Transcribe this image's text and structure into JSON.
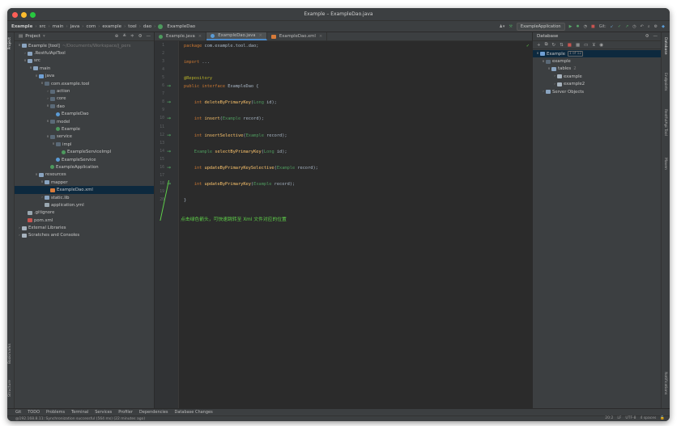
{
  "window": {
    "title": "Example – ExampleDao.java"
  },
  "breadcrumbs": [
    "Example",
    "src",
    "main",
    "java",
    "com",
    "example",
    "tool",
    "dao",
    "ExampleDao"
  ],
  "run_config": "ExampleApplication",
  "project_panel": {
    "title": "Project",
    "tree": [
      {
        "indent": 0,
        "arrow": "∨",
        "icon": "folder",
        "label": "Example [tool]",
        "muted": "~/Documents/Workspace/j_pers"
      },
      {
        "indent": 1,
        "arrow": "›",
        "icon": "folder",
        "label": ".RestfulApiTool"
      },
      {
        "indent": 1,
        "arrow": "∨",
        "icon": "folder",
        "label": "src"
      },
      {
        "indent": 2,
        "arrow": "∨",
        "icon": "folder",
        "label": "main"
      },
      {
        "indent": 3,
        "arrow": "∨",
        "icon": "src",
        "label": "java"
      },
      {
        "indent": 4,
        "arrow": "∨",
        "icon": "pkg",
        "label": "com.example.tool"
      },
      {
        "indent": 5,
        "arrow": "›",
        "icon": "pkg",
        "label": "action"
      },
      {
        "indent": 5,
        "arrow": "›",
        "icon": "pkg",
        "label": "core"
      },
      {
        "indent": 5,
        "arrow": "∨",
        "icon": "pkg",
        "label": "dao"
      },
      {
        "indent": 6,
        "arrow": "",
        "icon": "iface",
        "label": "ExampleDao"
      },
      {
        "indent": 5,
        "arrow": "∨",
        "icon": "pkg",
        "label": "model"
      },
      {
        "indent": 6,
        "arrow": "",
        "icon": "cls",
        "label": "Example"
      },
      {
        "indent": 5,
        "arrow": "∨",
        "icon": "pkg",
        "label": "service"
      },
      {
        "indent": 6,
        "arrow": "∨",
        "icon": "pkg",
        "label": "impl"
      },
      {
        "indent": 7,
        "arrow": "",
        "icon": "cls",
        "label": "ExampleServiceImpl"
      },
      {
        "indent": 6,
        "arrow": "",
        "icon": "iface",
        "label": "ExampleService"
      },
      {
        "indent": 5,
        "arrow": "",
        "icon": "cls",
        "label": "ExampleApplication"
      },
      {
        "indent": 3,
        "arrow": "∨",
        "icon": "folder",
        "label": "resources"
      },
      {
        "indent": 4,
        "arrow": "∨",
        "icon": "folder",
        "label": "mapper"
      },
      {
        "indent": 5,
        "arrow": "",
        "icon": "xml",
        "label": "ExampleDao.xml",
        "selected": true
      },
      {
        "indent": 4,
        "arrow": "›",
        "icon": "folder",
        "label": "static.lib"
      },
      {
        "indent": 4,
        "arrow": "",
        "icon": "file",
        "label": "application.yml"
      },
      {
        "indent": 1,
        "arrow": "",
        "icon": "file",
        "label": ".gitignore"
      },
      {
        "indent": 1,
        "arrow": "",
        "icon": "mvn",
        "label": "pom.xml"
      },
      {
        "indent": 0,
        "arrow": "›",
        "icon": "lib",
        "label": "External Libraries"
      },
      {
        "indent": 0,
        "arrow": "›",
        "icon": "lib",
        "label": "Scratches and Consoles"
      }
    ]
  },
  "editor": {
    "tabs": [
      {
        "label": "Example.java",
        "active": false
      },
      {
        "label": "ExampleDao.java",
        "active": true
      },
      {
        "label": "ExampleDao.xml",
        "active": false
      }
    ],
    "lines": [
      {
        "n": "1",
        "arrow": false,
        "parts": [
          [
            "kw",
            "package "
          ],
          [
            "pkg",
            "com.example.tool.dao"
          ],
          [
            "",
            "; "
          ]
        ]
      },
      {
        "n": "2",
        "arrow": false,
        "parts": []
      },
      {
        "n": "3",
        "arrow": false,
        "parts": [
          [
            "kw",
            "import "
          ],
          [
            "",
            "..."
          ]
        ]
      },
      {
        "n": "4",
        "arrow": false,
        "parts": []
      },
      {
        "n": "5",
        "arrow": false,
        "parts": [
          [
            "ann",
            "@Repository"
          ]
        ]
      },
      {
        "n": "6",
        "arrow": true,
        "parts": [
          [
            "kw",
            "public interface "
          ],
          [
            "",
            "ExampleDao {"
          ]
        ]
      },
      {
        "n": "7",
        "arrow": false,
        "parts": []
      },
      {
        "n": "8",
        "arrow": true,
        "parts": [
          [
            "kw",
            "    int "
          ],
          [
            "fn",
            "deleteByPrimaryKey"
          ],
          [
            "",
            "("
          ],
          [
            "typ",
            "Long"
          ],
          [
            "",
            " id);"
          ]
        ]
      },
      {
        "n": "9",
        "arrow": false,
        "parts": []
      },
      {
        "n": "10",
        "arrow": true,
        "parts": [
          [
            "kw",
            "    int "
          ],
          [
            "fn",
            "insert"
          ],
          [
            "",
            "("
          ],
          [
            "typ",
            "Example"
          ],
          [
            "",
            " record);"
          ]
        ]
      },
      {
        "n": "11",
        "arrow": false,
        "parts": []
      },
      {
        "n": "12",
        "arrow": true,
        "parts": [
          [
            "kw",
            "    int "
          ],
          [
            "fn",
            "insertSelective"
          ],
          [
            "",
            "("
          ],
          [
            "typ",
            "Example"
          ],
          [
            "",
            " record);"
          ]
        ]
      },
      {
        "n": "13",
        "arrow": false,
        "parts": []
      },
      {
        "n": "14",
        "arrow": true,
        "parts": [
          [
            "typ",
            "    Example "
          ],
          [
            "fn",
            "selectByPrimaryKey"
          ],
          [
            "",
            "("
          ],
          [
            "typ",
            "Long"
          ],
          [
            "",
            " id);"
          ]
        ]
      },
      {
        "n": "15",
        "arrow": false,
        "parts": []
      },
      {
        "n": "16",
        "arrow": true,
        "parts": [
          [
            "kw",
            "    int "
          ],
          [
            "fn",
            "updateByPrimaryKeySelective"
          ],
          [
            "",
            "("
          ],
          [
            "typ",
            "Example"
          ],
          [
            "",
            " record);"
          ]
        ]
      },
      {
        "n": "17",
        "arrow": false,
        "parts": []
      },
      {
        "n": "18",
        "arrow": true,
        "parts": [
          [
            "kw",
            "    int "
          ],
          [
            "fn",
            "updateByPrimaryKey"
          ],
          [
            "",
            "("
          ],
          [
            "typ",
            "Example"
          ],
          [
            "",
            " record);"
          ]
        ]
      },
      {
        "n": "19",
        "arrow": false,
        "parts": []
      },
      {
        "n": "20",
        "arrow": false,
        "parts": [
          [
            "",
            "}"
          ]
        ]
      }
    ],
    "annotation": "点击绿色箭头，可快速跳转至 Xml 文件对应的位置"
  },
  "database_panel": {
    "title": "Database",
    "tree": [
      {
        "indent": 0,
        "arrow": "∨",
        "icon": "src",
        "label": "Example",
        "badge": "1 of 12",
        "selected": true
      },
      {
        "indent": 1,
        "arrow": "∨",
        "icon": "pkg",
        "label": "example"
      },
      {
        "indent": 2,
        "arrow": "∨",
        "icon": "folder",
        "label": "tables",
        "muted": "2"
      },
      {
        "indent": 3,
        "arrow": "›",
        "icon": "lib",
        "label": "example"
      },
      {
        "indent": 3,
        "arrow": "›",
        "icon": "lib",
        "label": "example2"
      },
      {
        "indent": 1,
        "arrow": "›",
        "icon": "folder",
        "label": "Server Objects"
      }
    ]
  },
  "left_strip": [
    "Project",
    "Bookmarks",
    "Structure"
  ],
  "right_strip": [
    "Database",
    "Endpoints",
    "RestfulApi Tool",
    "Maven",
    "Notifications"
  ],
  "bottom_tools": [
    "Git",
    "TODO",
    "Problems",
    "Terminal",
    "Services",
    "Profiler",
    "Dependencies",
    "Database Changes"
  ],
  "status": {
    "message": "@192.168.8.11: Synchronization successful (564 ms) (22 minutes ago)",
    "position": "20:2",
    "line_sep": "LF",
    "encoding": "UTF-8",
    "indent": "4 spaces"
  },
  "colors": {
    "accent": "#4a88c7",
    "gutter_arrow": "#4e9a5e",
    "annotation": "#5fd14a"
  }
}
